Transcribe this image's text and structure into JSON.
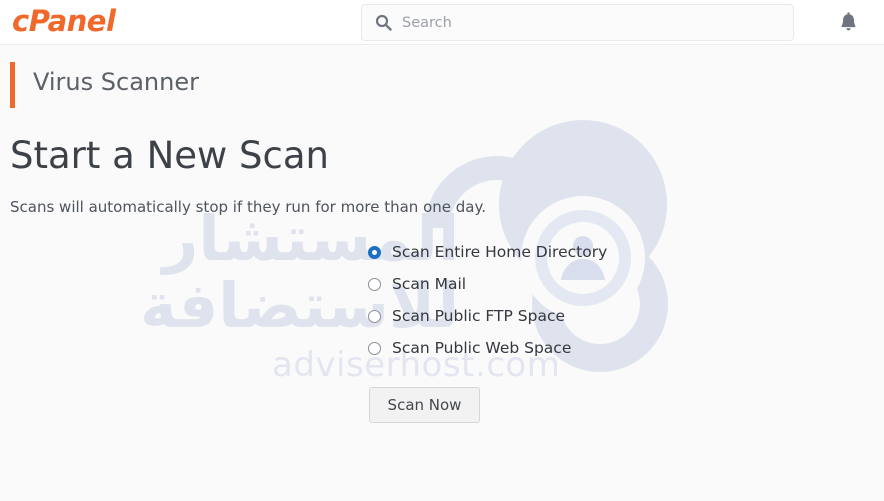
{
  "header": {
    "brand": "cPanel",
    "search": {
      "placeholder": "Search",
      "value": "",
      "icon": "search-icon"
    },
    "notifications_icon": "bell-icon"
  },
  "page": {
    "title": "Virus Scanner",
    "accent_color": "#f0682a",
    "heading": "Start a New Scan",
    "description": "Scans will automatically stop if they run for more than one day."
  },
  "scan_options": {
    "selected_index": 0,
    "items": [
      {
        "label": "Scan Entire Home Directory",
        "checked": true
      },
      {
        "label": "Scan Mail",
        "checked": false
      },
      {
        "label": "Scan Public FTP Space",
        "checked": false
      },
      {
        "label": "Scan Public Web Space",
        "checked": false
      }
    ]
  },
  "actions": {
    "scan_now_label": "Scan Now"
  },
  "watermark": {
    "arabic_line1": "المستشار",
    "arabic_line2": "للاستضافة",
    "domain": "adviserhost.com",
    "color": "#e1e5f0"
  },
  "colors": {
    "brand_orange": "#f0682a",
    "radio_blue": "#1b6fc4",
    "page_background": "#fafafa",
    "header_background": "#ffffff"
  }
}
